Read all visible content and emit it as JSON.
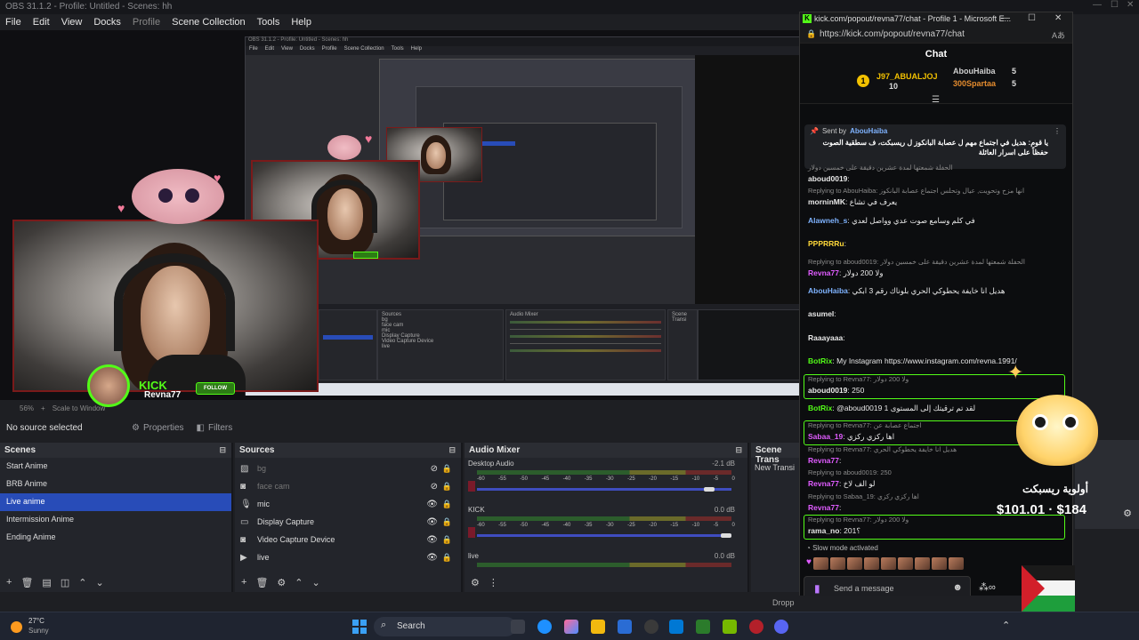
{
  "obs": {
    "title": "OBS 31.1.2 - Profile: Untitled - Scenes: hh",
    "menu": [
      "File",
      "Edit",
      "View",
      "Docks",
      "Profile",
      "Scene Collection",
      "Tools",
      "Help"
    ],
    "zoom": "56%",
    "scale_label": "Scale to Window",
    "no_source": "No source selected",
    "properties_label": "Properties",
    "filters_label": "Filters",
    "dropped": "Dropp"
  },
  "nested": {
    "menu": [
      "File",
      "Edit",
      "View",
      "Docks",
      "Profile",
      "Scene Collection",
      "Tools",
      "Help"
    ],
    "sources_title": "Sources",
    "mixer_title": "Audio Mixer",
    "scene_trans": "Scene Transi",
    "source_items": [
      "bg",
      "face cam",
      "mic",
      "Display Capture",
      "Video Capture Device",
      "live"
    ]
  },
  "overlay": {
    "kick_label": "KICK",
    "kick_name": "Revna77",
    "follow_label": "FOLLOW",
    "goal_text": "أولوية ريسبكت",
    "goal_amount": "$101.01 · $184"
  },
  "scenes": {
    "title": "Scenes",
    "items": [
      "Start Anime",
      "BRB Anime",
      "Live anime",
      "Intermission Anime",
      "Ending Anime"
    ],
    "active_index": 2
  },
  "sources": {
    "title": "Sources",
    "items": [
      {
        "name": "bg",
        "icon": "image-icon",
        "visible": false
      },
      {
        "name": "face cam",
        "icon": "camera-icon",
        "visible": false
      },
      {
        "name": "mic",
        "icon": "mic-icon",
        "visible": true
      },
      {
        "name": "Display Capture",
        "icon": "monitor-icon",
        "visible": true
      },
      {
        "name": "Video Capture Device",
        "icon": "camera-icon",
        "visible": true
      },
      {
        "name": "live",
        "icon": "play-icon",
        "visible": true
      }
    ]
  },
  "mixer": {
    "title": "Audio Mixer",
    "ticks": [
      "-60",
      "-55",
      "-50",
      "-45",
      "-40",
      "-35",
      "-30",
      "-25",
      "-20",
      "-15",
      "-10",
      "-5",
      "0"
    ],
    "channels": [
      {
        "name": "Desktop Audio",
        "db": "-2.1 dB",
        "level": 0.93
      },
      {
        "name": "KICK",
        "db": "0.0 dB",
        "level": 1.0
      },
      {
        "name": "live",
        "db": "0.0 dB",
        "level": 1.0
      }
    ]
  },
  "transitions": {
    "title": "Scene Trans",
    "new_label": "New Transi"
  },
  "browser": {
    "title": "kick.com/popout/revna77/chat - Profile 1 - Microsoft E...",
    "url": "https://kick.com/popout/revna77/chat",
    "chat_title": "Chat",
    "leaderboard": [
      {
        "name": "J97_ABUALJOJ",
        "count": "10",
        "color": "#f2c100"
      },
      {
        "name": "AbouHaiba",
        "count": "5",
        "color": "#cfcfcf"
      },
      {
        "name": "300Spartaa",
        "count": "5",
        "color": "#e58c2e"
      }
    ],
    "pinned": {
      "sent_by_label": "Sent by",
      "sender": "AbouHaiba",
      "text": "يا قوم: هديل في اجتماع مهم ل عصابة البانكوز ل ريسبكت، ف سطقية الصوت حفظاً على اسرار العائلة"
    },
    "messages": [
      {
        "reply": "الحفلة شمعتها لمدة عشرين دقيقة على خمسين دولار",
        "user": "aboud0019",
        "color": "#e8e8e8",
        "text": "",
        "highlight": false
      },
      {
        "reply": "Replying to AbouHaiba: انها مزح وتحويت, عيال وتحلس اجتماع عصابة البانكوز",
        "user": "morninMK",
        "color": "#e8e8e8",
        "text": "يعرف في تشاع",
        "highlight": false
      },
      {
        "reply": "",
        "user": "Alawneh_s",
        "color": "#7fb3ff",
        "text": "في كلم وسامع صوت عدي وواصل لعدي",
        "highlight": false
      },
      {
        "reply": "",
        "user": "PPPRRRu",
        "color": "#ffd83a",
        "text": "",
        "highlight": false
      },
      {
        "reply": "Replying to aboud0019: الحفلة شمعتها لمدة عشرين دقيقة على خمسين دولار",
        "user": "Revna77",
        "color": "#e05cff",
        "text": "ولا 200 دولار",
        "highlight": false
      },
      {
        "reply": "",
        "user": "AbouHaiba",
        "color": "#7fb3ff",
        "text": "هديل انا خايفة يحطوكي الحري بلوناك رقم 3 ابكي",
        "highlight": false
      },
      {
        "reply": "",
        "user": "asumel",
        "color": "#e8e8e8",
        "text": "",
        "highlight": false
      },
      {
        "reply": "",
        "user": "Raaayaaa",
        "color": "#e8e8e8",
        "text": "",
        "highlight": false
      },
      {
        "reply": "",
        "user": "BotRix",
        "color": "#53fc18",
        "text": "My Instagram https://www.instagram.com/revna.1991/",
        "highlight": false
      },
      {
        "reply": "Replying to Revna77: ولا 200 دولار",
        "user": "aboud0019",
        "color": "#e8e8e8",
        "text": "250",
        "highlight": true
      },
      {
        "reply": "",
        "user": "BotRix",
        "color": "#53fc18",
        "text": "@aboud0019 لقد تم ترقيتك إلى المستوى 1",
        "highlight": false
      },
      {
        "reply": "Replying to Revna77: اجتماع عصابة عن",
        "user": "Sabaa_19",
        "color": "#e05cff",
        "text": "اها ركزي ركزي",
        "highlight": true
      },
      {
        "reply": "Replying to Revna77: هديل انا خايفة يحطوكي الحري",
        "user": "Revna77",
        "color": "#e05cff",
        "text": "",
        "highlight": false
      },
      {
        "reply": "Replying to aboud0019: 250",
        "user": "Revna77",
        "color": "#e05cff",
        "text": "لو الف لاخ",
        "highlight": false
      },
      {
        "reply": "Replying to Sabaa_19: اها ركزي ركزي",
        "user": "Revna77",
        "color": "#e05cff",
        "text": "",
        "highlight": false
      },
      {
        "reply": "Replying to Revna77: ولا 200 دولار",
        "user": "rama_no",
        "color": "#e8e8e8",
        "text": "201؟",
        "highlight": true
      }
    ],
    "slow_mode": "Slow mode activated",
    "send_placeholder": "Send a message"
  },
  "taskbar": {
    "temp": "27°C",
    "weather": "Sunny",
    "search": "Search"
  }
}
